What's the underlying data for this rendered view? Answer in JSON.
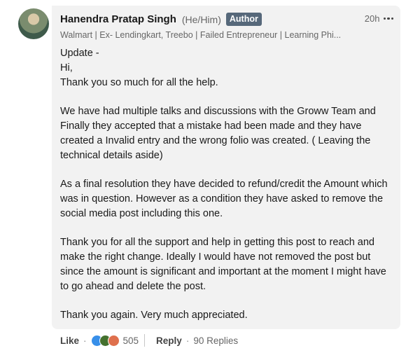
{
  "comment": {
    "author_name": "Hanendra Pratap Singh",
    "pronouns": "(He/Him)",
    "badge": "Author",
    "timestamp": "20h",
    "headline": "Walmart | Ex- Lendingkart, Treebo | Failed Entrepreneur | Learning Phi...",
    "paragraphs": [
      "Update -\nHi,\nThank you so much for all the help.",
      "We have had multiple talks and discussions with the Groww Team and Finally they accepted that a mistake had been made and they have created a Invalid entry and the wrong folio was created. ( Leaving the technical details aside)",
      "As a final resolution they have decided to refund/credit the Amount which was in question. However as a condition they have asked to remove the social media post including this one.",
      "Thank you for all the support and help in getting this post to reach and make the right change. Ideally I would have not removed the post but since the amount is significant and important at the moment I might have to go ahead and delete the post.",
      "Thank you again. Very much appreciated."
    ]
  },
  "actions": {
    "like_label": "Like",
    "separator": "·",
    "reaction_count": "505",
    "reply_label": "Reply",
    "replies_text": "90 Replies",
    "reaction_icons": [
      "like-icon",
      "celebrate-icon",
      "love-icon"
    ]
  }
}
